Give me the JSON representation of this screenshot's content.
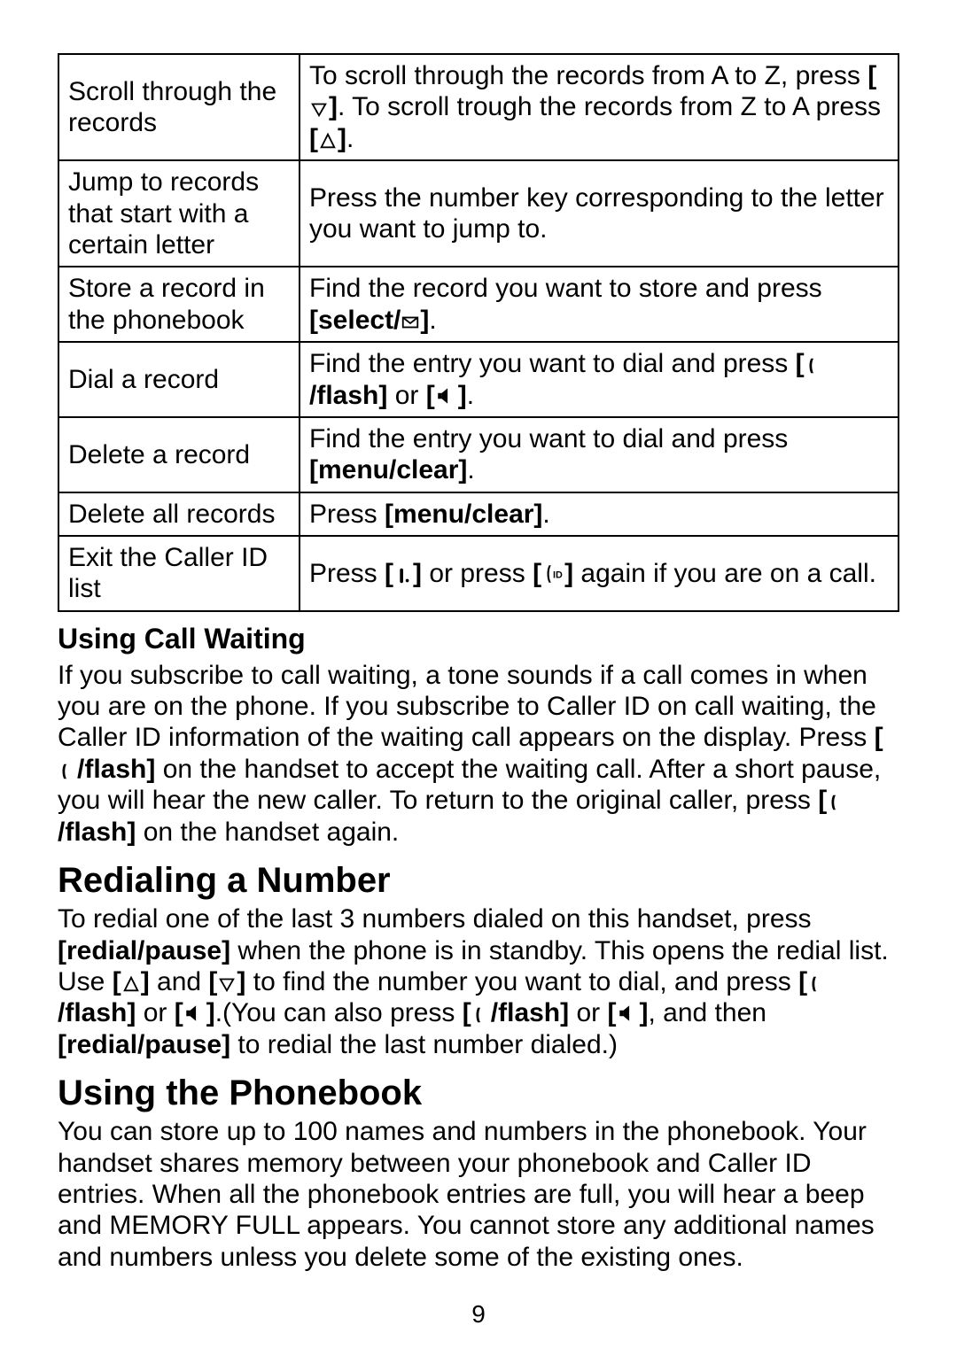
{
  "table": {
    "rows": [
      {
        "left": "Scroll through the records",
        "right_pre": "To scroll through the records from A to Z, press ",
        "right_mid": ". To scroll trough the records from Z to A press ",
        "right_post": "."
      },
      {
        "left": "Jump to records that start with a certain letter",
        "right": "Press the number key corresponding to the letter you want to jump to."
      },
      {
        "left": "Store a record in the phonebook",
        "right_pre": "Find the record you want to store and press ",
        "right_bold_open": "[select/",
        "right_bold_close": "]",
        "right_post": "."
      },
      {
        "left": "Dial a record",
        "right_pre": "Find the entry you want to dial and press ",
        "right_bold1": "/flash]",
        "right_mid": " or ",
        "right_post": "."
      },
      {
        "left": "Delete a record",
        "right_pre": "Find the entry you want to dial and press ",
        "right_bold": "[menu/clear]",
        "right_post": "."
      },
      {
        "left": "Delete all records",
        "right_pre": "Press ",
        "right_bold": "[menu/clear]",
        "right_post": "."
      },
      {
        "left": "Exit the Caller ID list",
        "right_pre": "Press ",
        "right_mid": " or press ",
        "right_post": " again if you are on a call."
      }
    ]
  },
  "sections": {
    "call_waiting": {
      "title": "Using Call Waiting",
      "p1a": "If you subscribe to call waiting, a tone sounds if a call comes in when you are on the phone. If you subscribe to Caller ID on call waiting, the Caller ID information of the waiting call appears on the display. Press ",
      "p1_flash": "/flash]",
      "p1b": " on the handset to accept the waiting call. After a short pause, you will hear the new caller. To return to the original caller, press ",
      "p1c": " on the handset again."
    },
    "redial": {
      "title": "Redialing a Number",
      "p_a": "To redial one of the last 3 numbers dialed on this handset, press ",
      "p_redial": "[redial/pause]",
      "p_b": " when the phone is in standby. This opens the redial list. Use ",
      "p_and": " and ",
      "p_c": " to find the number you want to dial, and press ",
      "p_flash": "/flash]",
      "p_or": " or ",
      "p_d": ".(You can also press ",
      "p_or2": " or ",
      "p_e": ", and then ",
      "p_f": " to redial the last number dialed.)"
    },
    "phonebook": {
      "title": "Using the Phonebook",
      "p": "You can store up to 100 names and numbers in the phonebook. Your handset shares memory between your phonebook and Caller ID entries. When all the phonebook entries are full, you will hear a beep and MEMORY FULL appears. You cannot store any additional names and numbers unless you delete some of the existing ones."
    }
  },
  "page_number": "9"
}
